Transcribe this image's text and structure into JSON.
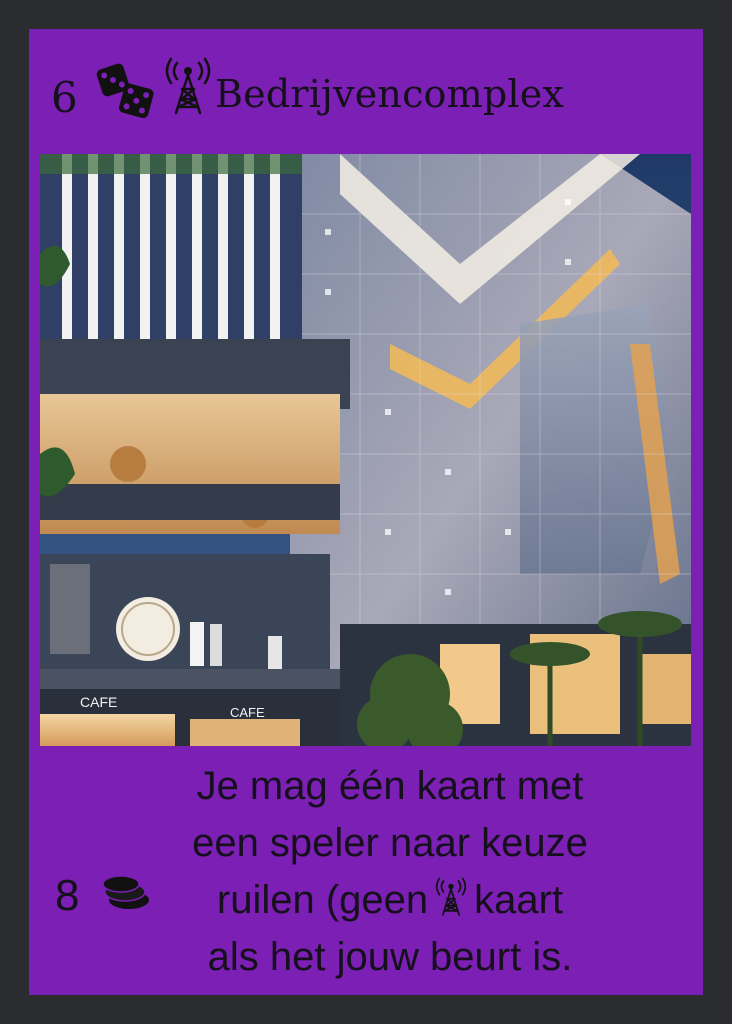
{
  "card": {
    "roll_number": "6",
    "title": "Bedrijvencomplex",
    "cost": "8",
    "effect": {
      "line1": "Je mag één kaart met",
      "line2": "een speler naar keuze",
      "line3_before_icon": "ruilen (geen",
      "line3_after_icon": "kaart",
      "line4": "als het jouw beurt is."
    },
    "illustration": {
      "signs": [
        "CAFE",
        "CAFE"
      ]
    },
    "icons": {
      "activation": "dice-icon",
      "category": "radio-tower-icon",
      "cost": "coins-icon"
    },
    "colors": {
      "card_background": "#7b1fb5",
      "frame": "#2b2c2f",
      "text": "#16101c"
    }
  }
}
